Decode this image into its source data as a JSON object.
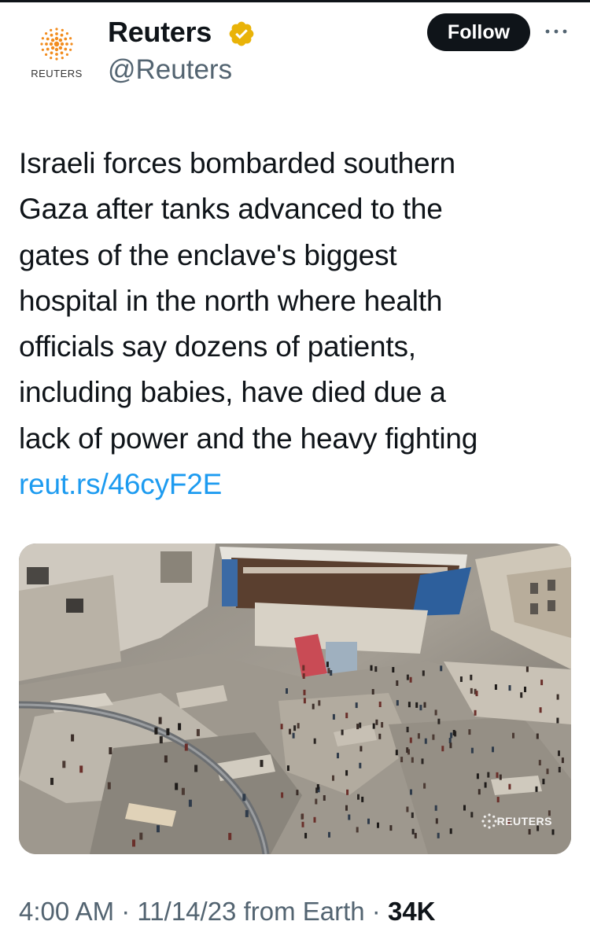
{
  "account": {
    "display_name": "Reuters",
    "handle": "@Reuters",
    "avatar_wordmark": "REUTERS",
    "verified_color": "#e9b308"
  },
  "actions": {
    "follow_label": "Follow"
  },
  "tweet": {
    "lines": [
      "Israeli forces bombarded southern",
      "Gaza after tanks advanced to the",
      "gates of the enclave's biggest",
      "hospital in the north where health",
      "officials say dozens of patients,",
      "including babies, have died due a",
      "lack of power and the heavy fighting"
    ],
    "link": "reut.rs/46cyF2E"
  },
  "media": {
    "watermark": "REUTERS"
  },
  "meta": {
    "time": "4:00 AM",
    "sep1": " · ",
    "date": "11/14/23",
    "source": " from Earth",
    "sep2": " · ",
    "views": "34K"
  },
  "colors": {
    "text": "#0f1419",
    "secondary": "#536471",
    "link": "#1d9bf0",
    "reuters_orange": "#f28c1e"
  }
}
